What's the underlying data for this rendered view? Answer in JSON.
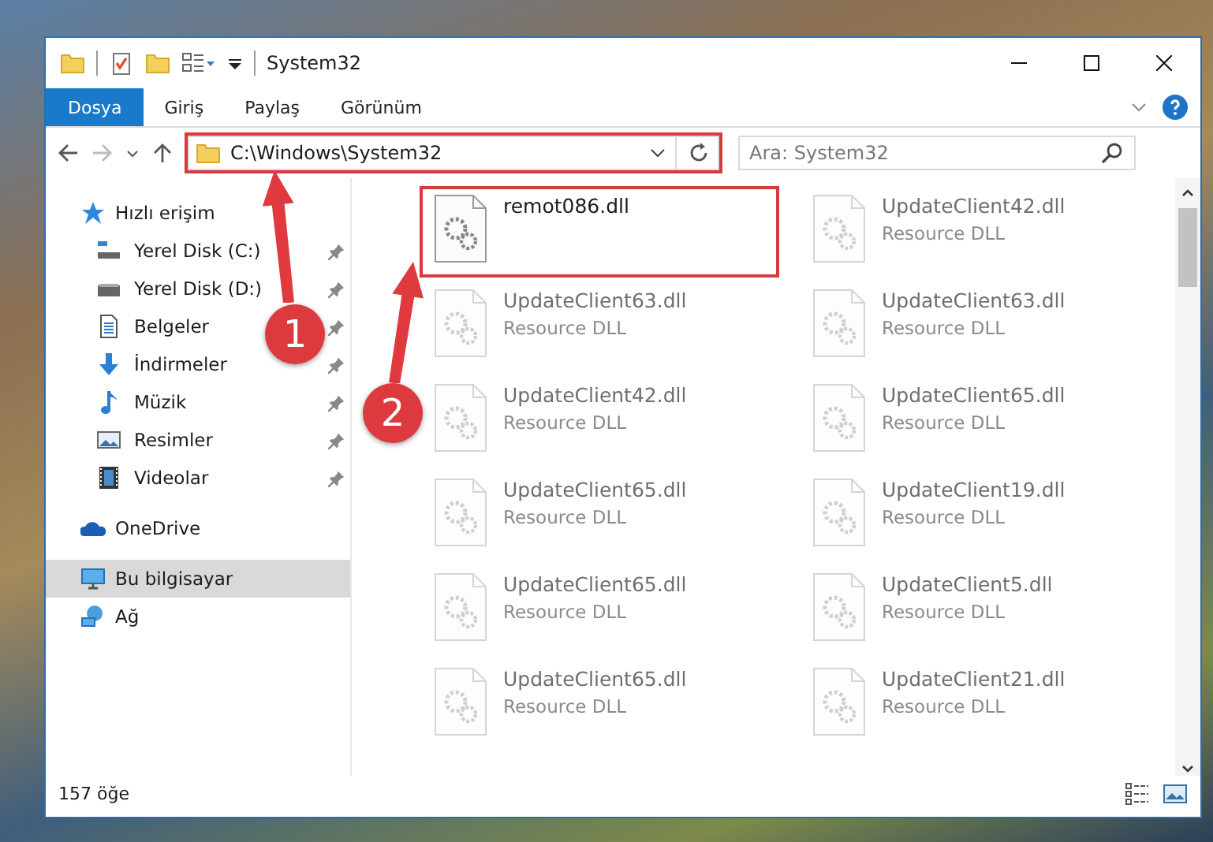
{
  "window": {
    "title": "System32"
  },
  "ribbon_tabs": [
    {
      "label": "Dosya",
      "selected": true
    },
    {
      "label": "Giriş",
      "selected": false
    },
    {
      "label": "Paylaş",
      "selected": false
    },
    {
      "label": "Görünüm",
      "selected": false
    }
  ],
  "address_bar": {
    "path": "C:\\Windows\\System32",
    "highlighted": true
  },
  "search": {
    "placeholder": "Ara: System32"
  },
  "sidebar": {
    "items": [
      {
        "label": "Hızlı erişim",
        "kind": "star",
        "selected": false,
        "children": [
          {
            "label": "Yerel Disk (C:)",
            "kind": "drive-c",
            "pinned": true
          },
          {
            "label": "Yerel Disk (D:)",
            "kind": "drive",
            "pinned": true
          },
          {
            "label": "Belgeler",
            "kind": "document",
            "pinned": true
          },
          {
            "label": "İndirmeler",
            "kind": "download",
            "pinned": true
          },
          {
            "label": "Müzik",
            "kind": "music",
            "pinned": true
          },
          {
            "label": "Resimler",
            "kind": "pictures",
            "pinned": true
          },
          {
            "label": "Videolar",
            "kind": "video",
            "pinned": true
          }
        ]
      },
      {
        "label": "OneDrive",
        "kind": "cloud",
        "selected": false
      },
      {
        "label": "Bu bilgisayar",
        "kind": "computer",
        "selected": true
      },
      {
        "label": "Ağ",
        "kind": "network",
        "selected": false
      }
    ]
  },
  "files": [
    {
      "name": "remot086.dll",
      "highlighted": true,
      "blurred": false
    },
    {
      "name": "UpdateClient42.dll",
      "type": "Resource DLL",
      "highlighted": false,
      "blurred": true
    },
    {
      "name": "UpdateClient63.dll",
      "type": "Resource DLL",
      "highlighted": false,
      "blurred": true
    },
    {
      "name": "UpdateClient63.dll",
      "type": "Resource DLL",
      "highlighted": false,
      "blurred": true
    },
    {
      "name": "UpdateClient42.dll",
      "type": "Resource DLL",
      "highlighted": false,
      "blurred": true
    },
    {
      "name": "UpdateClient65.dll",
      "type": "Resource DLL",
      "highlighted": false,
      "blurred": true
    },
    {
      "name": "UpdateClient65.dll",
      "type": "Resource DLL",
      "highlighted": false,
      "blurred": true
    },
    {
      "name": "UpdateClient19.dll",
      "type": "Resource DLL",
      "highlighted": false,
      "blurred": true
    },
    {
      "name": "UpdateClient65.dll",
      "type": "Resource DLL",
      "highlighted": false,
      "blurred": true
    },
    {
      "name": "UpdateClient5.dll",
      "type": "Resource DLL",
      "highlighted": false,
      "blurred": true
    },
    {
      "name": "UpdateClient65.dll",
      "type": "Resource DLL",
      "highlighted": false,
      "blurred": true
    },
    {
      "name": "UpdateClient21.dll",
      "type": "Resource DLL",
      "highlighted": false,
      "blurred": true
    }
  ],
  "status_bar": {
    "item_count": "157 öğe"
  },
  "annotations": [
    {
      "label": "1"
    },
    {
      "label": "2"
    }
  ]
}
